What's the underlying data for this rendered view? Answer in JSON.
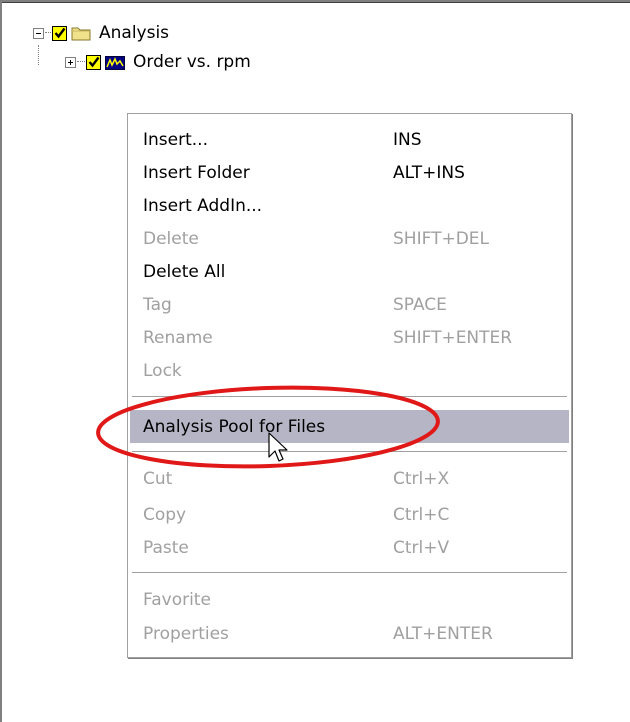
{
  "tree": {
    "root_label": "Analysis",
    "child_label": "Order vs. rpm"
  },
  "menu": {
    "items": [
      {
        "label": "Insert...",
        "shortcut": "INS",
        "enabled": true
      },
      {
        "label": "Insert Folder",
        "shortcut": "ALT+INS",
        "enabled": true
      },
      {
        "label": "Insert AddIn...",
        "shortcut": "",
        "enabled": true
      },
      {
        "label": "Delete",
        "shortcut": "SHIFT+DEL",
        "enabled": false
      },
      {
        "label": "Delete All",
        "shortcut": "",
        "enabled": true
      },
      {
        "label": "Tag",
        "shortcut": "SPACE",
        "enabled": false
      },
      {
        "label": "Rename",
        "shortcut": "SHIFT+ENTER",
        "enabled": false
      },
      {
        "label": "Lock",
        "shortcut": "",
        "enabled": false
      },
      {
        "label": "Analysis Pool for Files",
        "shortcut": "",
        "enabled": true,
        "highlighted": true
      },
      {
        "label": "Cut",
        "shortcut": "Ctrl+X",
        "enabled": false
      },
      {
        "label": "Copy",
        "shortcut": "Ctrl+C",
        "enabled": false
      },
      {
        "label": "Paste",
        "shortcut": "Ctrl+V",
        "enabled": false
      },
      {
        "label": "Favorite",
        "shortcut": "",
        "enabled": false
      },
      {
        "label": "Properties",
        "shortcut": "ALT+ENTER",
        "enabled": false
      }
    ]
  },
  "colors": {
    "highlight": "#b5b5c6",
    "disabled_text": "#a0a0a0",
    "annotation": "#e01818",
    "checkbox": "#ffff00"
  }
}
